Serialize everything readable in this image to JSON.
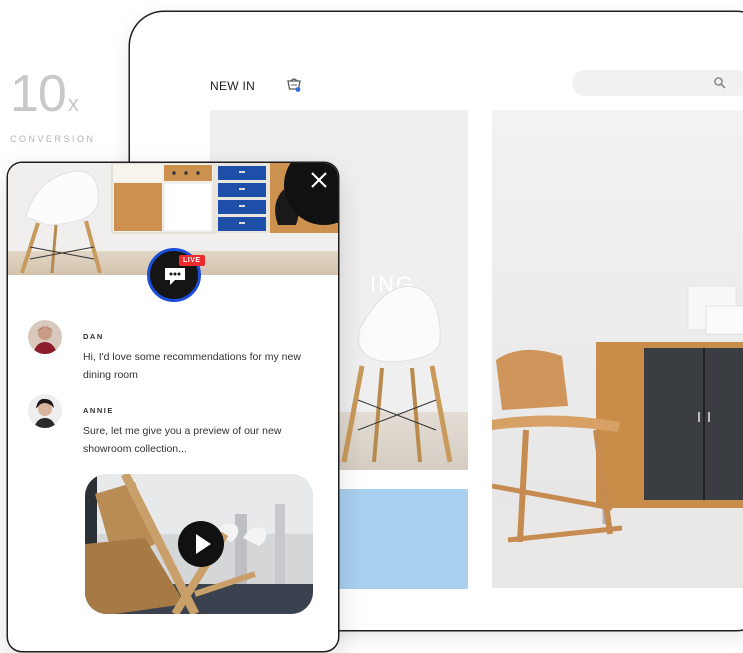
{
  "stat": {
    "number": "10",
    "suffix": "x",
    "label": "CONVERSION"
  },
  "shop": {
    "nav_new_in": "NEW IN",
    "hero_word": "ING"
  },
  "chat": {
    "live_badge": "LIVE",
    "messages": [
      {
        "name": "DAN",
        "text": "Hi, I'd love some recommendations for my new dining room"
      },
      {
        "name": "ANNIE",
        "text": "Sure, let me give you a preview of our new showroom collection..."
      }
    ]
  },
  "icons": {
    "close": "close-icon",
    "live_chat": "chat-bubble-icon",
    "cart": "cart-icon",
    "search": "search-icon",
    "play": "play-icon"
  },
  "colors": {
    "live_red": "#ee2a2a",
    "live_ring": "#1d4ed8",
    "blue_tile": "#a9d0ef",
    "cabinet_blue": "#1e4fa8"
  }
}
